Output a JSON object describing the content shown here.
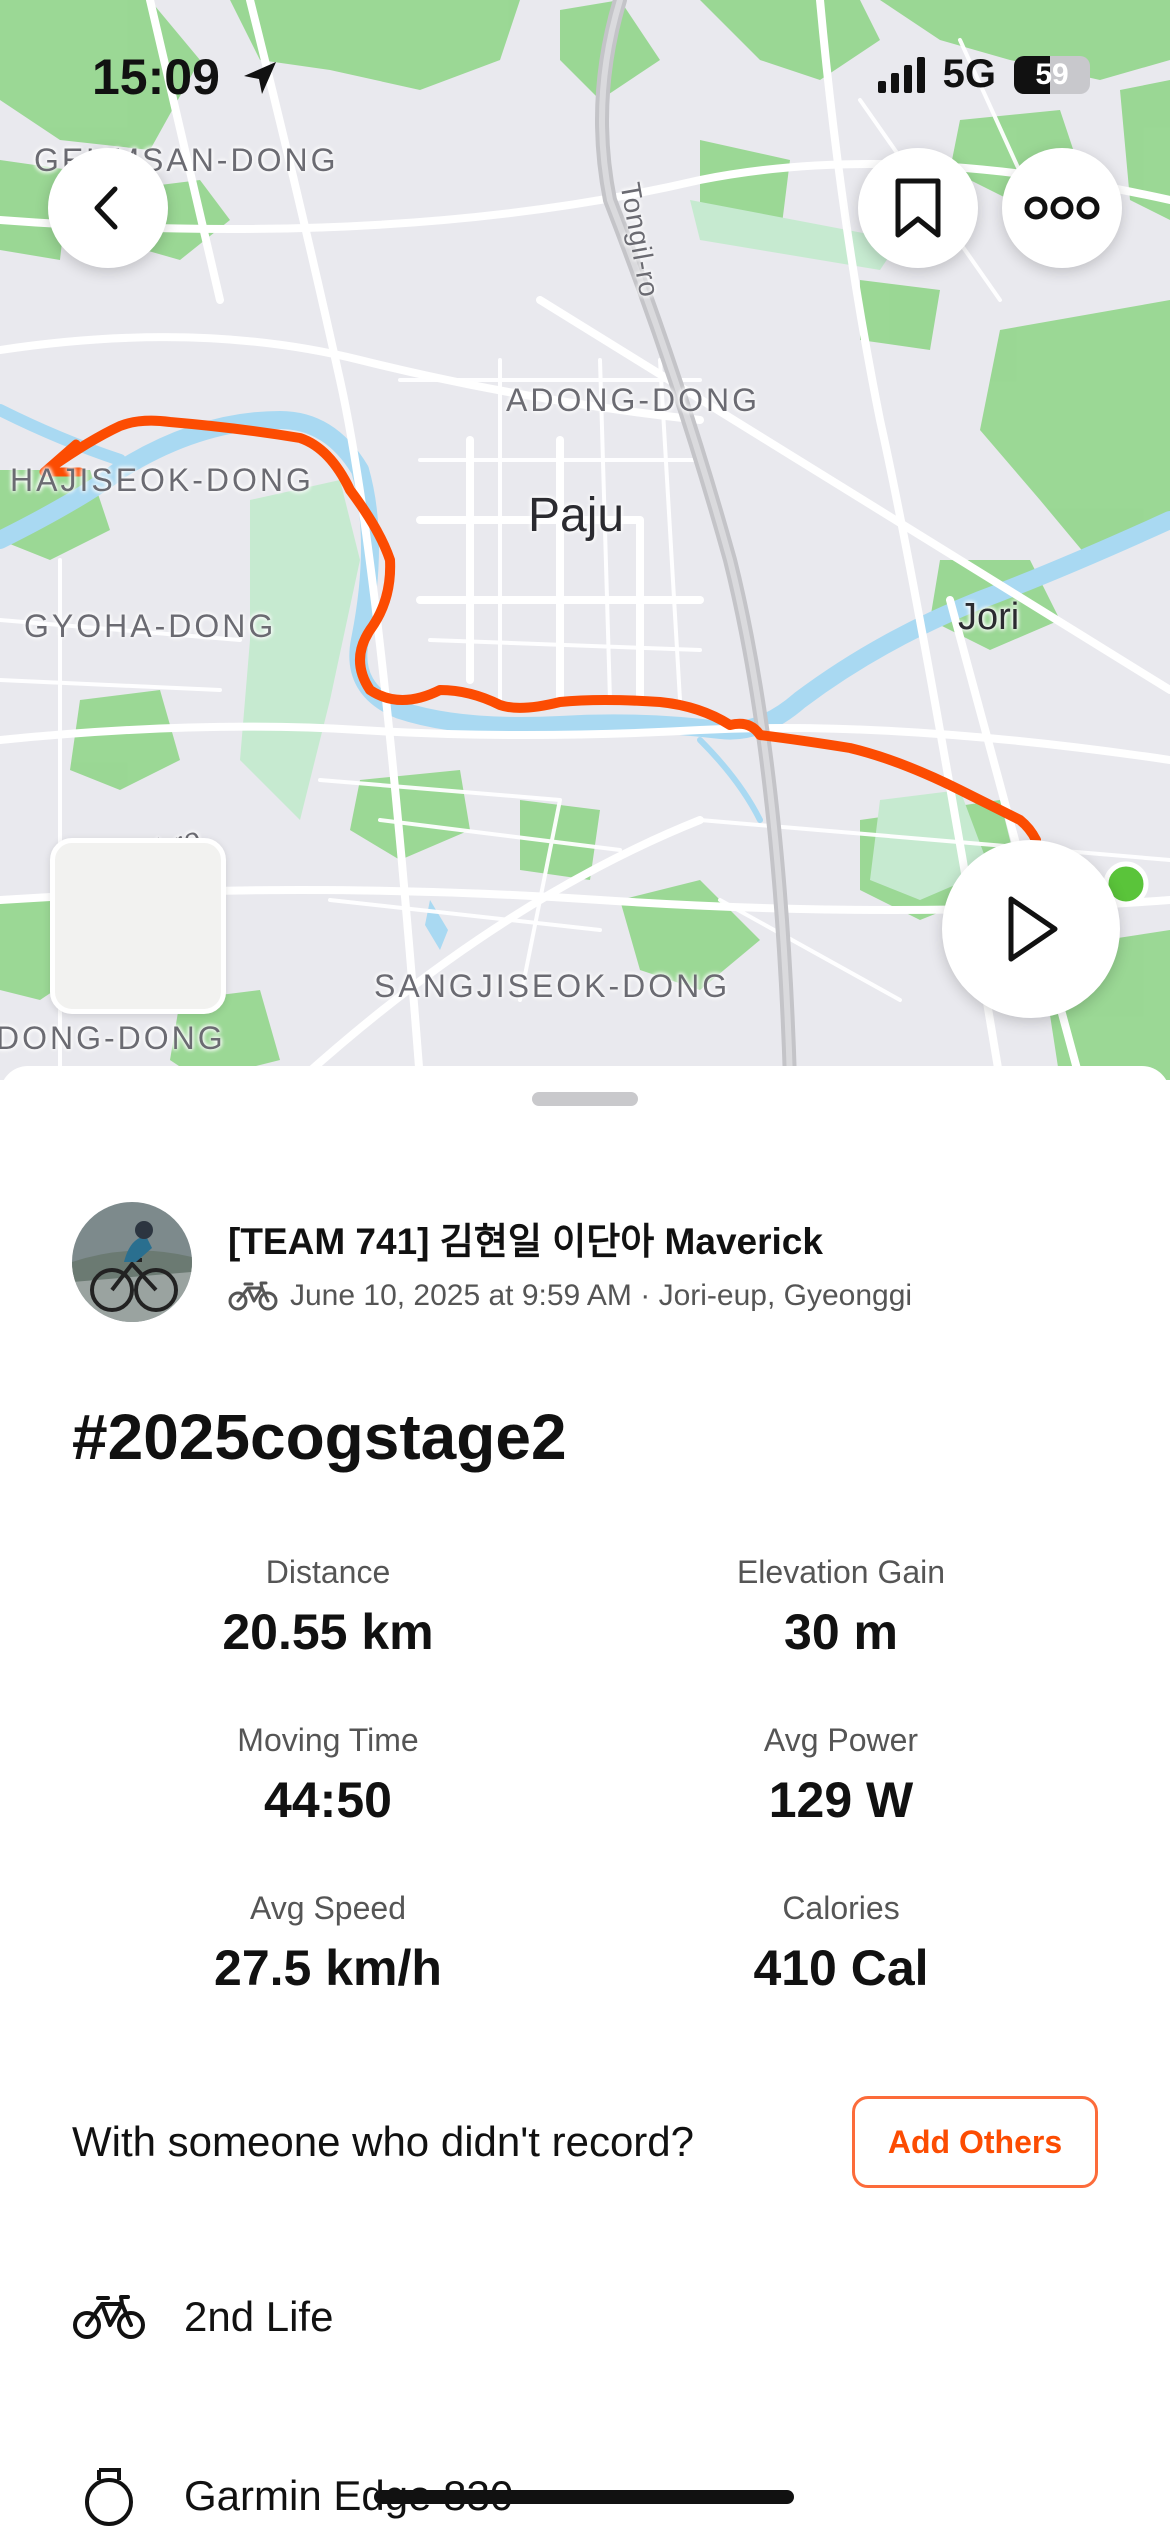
{
  "status_bar": {
    "time": "15:09",
    "network": "5G",
    "battery_percent": "59",
    "location_icon": "location-arrow-icon"
  },
  "map": {
    "labels": {
      "geumsan": "GEUMSAN-DONG",
      "tongil": "Tongil-ro",
      "adong": "ADONG-DONG",
      "hajiseok": "HAJISEOK-DONG",
      "paju": "Paju",
      "gyoha": "GYOHA-DONG",
      "jori": "Jori",
      "road_ro": "il-ro",
      "sangjiseok": "SANGJISEOK-DONG",
      "dong": "DONG-DONG"
    },
    "colors": {
      "route": "#fc4c02",
      "start_dot": "#5ac43a",
      "water": "#a9d9f2",
      "park": "#8fd48a"
    },
    "buttons": {
      "back_icon": "chevron-left-icon",
      "bookmark_icon": "bookmark-icon",
      "more_icon": "more-dots-icon",
      "play_icon": "play-icon"
    }
  },
  "athlete": {
    "name": "[TEAM 741] 김현일 이단아 Maverick",
    "date": "June 10, 2025 at 9:59 AM · Jori-eup, Gyeonggi",
    "sport_icon": "bike-icon"
  },
  "activity": {
    "title": "#2025cogstage2"
  },
  "stats": [
    {
      "label": "Distance",
      "value": "20.55 km"
    },
    {
      "label": "Elevation Gain",
      "value": "30 m"
    },
    {
      "label": "Moving Time",
      "value": "44:50"
    },
    {
      "label": "Avg Power",
      "value": "129 W"
    },
    {
      "label": "Avg Speed",
      "value": "27.5 km/h"
    },
    {
      "label": "Calories",
      "value": "410 Cal"
    }
  ],
  "with_others": {
    "text": "With someone who didn't record?",
    "button": "Add Others"
  },
  "gear": {
    "bike": "2nd Life",
    "device": "Garmin Edge 830"
  },
  "accent_color": "#fc4c02"
}
